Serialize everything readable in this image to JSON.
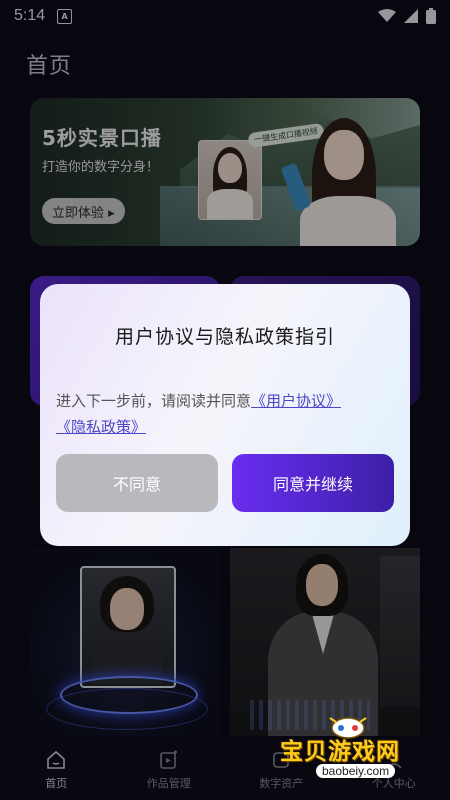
{
  "status_bar": {
    "time": "5:14",
    "notification_icon": "A"
  },
  "header": {
    "title": "首页"
  },
  "banner": {
    "title": "5秒实景口播",
    "subtitle": "打造你的数字分身！",
    "button_label": "立即体验 ▸",
    "tag": "一键生成口播视频"
  },
  "dialog": {
    "title": "用户协议与隐私政策指引",
    "body_prefix": "进入下一步前，请阅读并同意",
    "user_agreement_link": "《用户协议》",
    "privacy_policy_link": "《隐私政策》",
    "disagree_label": "不同意",
    "agree_label": "同意并继续"
  },
  "tabbar": {
    "items": [
      {
        "label": "首页",
        "icon": "home-icon",
        "active": true
      },
      {
        "label": "作品管理",
        "icon": "works-icon",
        "active": false
      },
      {
        "label": "数字资产",
        "icon": "assets-icon",
        "active": false
      },
      {
        "label": "个人中心",
        "icon": "profile-icon",
        "active": false
      }
    ]
  },
  "watermark": {
    "text": "宝贝游戏网",
    "url": "baobeiy.com"
  },
  "colors": {
    "accent_purple": "#6a2ef0",
    "accent_blue": "#3c1fa8",
    "link": "#4b48c8",
    "disagree_gray": "#b9b9bd"
  }
}
